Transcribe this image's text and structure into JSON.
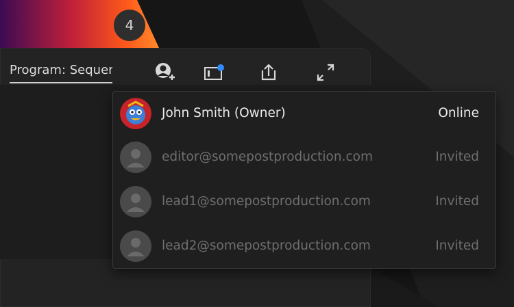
{
  "toolbar": {
    "collaborator_count": "4",
    "icons": [
      "add-user-icon",
      "notification-panel-icon",
      "share-icon",
      "fullscreen-icon"
    ]
  },
  "program_tab": {
    "label": "Program: Sequer"
  },
  "collaborators": [
    {
      "name": "John Smith (Owner)",
      "status": "Online",
      "avatar": "owner-avatar"
    },
    {
      "name": "editor@somepostproduction.com",
      "status": "Invited",
      "avatar": "placeholder-avatar"
    },
    {
      "name": "lead1@somepostproduction.com",
      "status": "Invited",
      "avatar": "placeholder-avatar"
    },
    {
      "name": "lead2@somepostproduction.com",
      "status": "Invited",
      "avatar": "placeholder-avatar"
    }
  ],
  "colors": {
    "accent_blue": "#2f8cff",
    "online_text": "#ececec",
    "invited_text": "#6f6f6f"
  }
}
